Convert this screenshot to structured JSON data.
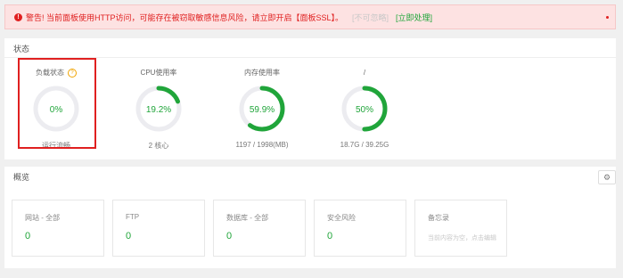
{
  "alert": {
    "text": "警告! 当前面板使用HTTP访问，可能存在被窃取敏感信息风险，请立即开启【面板SSL】。",
    "dismiss_label": "[不可忽略]",
    "fix_label": "[立即处理]"
  },
  "status": {
    "title": "状态",
    "gauges": [
      {
        "title": "负载状态",
        "value": "0%",
        "footer": "运行流畅",
        "percent": 0,
        "has_help": true
      },
      {
        "title": "CPU使用率",
        "value": "19.2%",
        "footer": "2 核心",
        "percent": 19.2,
        "has_help": false
      },
      {
        "title": "内存使用率",
        "value": "59.9%",
        "footer": "1197 / 1998(MB)",
        "percent": 59.9,
        "has_help": false
      },
      {
        "title": "/",
        "value": "50%",
        "footer": "18.7G / 39.25G",
        "percent": 50,
        "has_help": false
      }
    ]
  },
  "overview": {
    "title": "概览",
    "cards": [
      {
        "label": "网站 - 全部",
        "value": "0"
      },
      {
        "label": "FTP",
        "value": "0"
      },
      {
        "label": "数据库 - 全部",
        "value": "0"
      },
      {
        "label": "安全风险",
        "value": "0"
      },
      {
        "label": "备忘录",
        "hint": "当前内容为空，点击编辑"
      }
    ]
  },
  "colors": {
    "accent": "#20a53a",
    "danger": "#e02020",
    "track": "#ececf0"
  },
  "icons": {
    "alert": "warning-circle-icon",
    "help": "question-circle-icon",
    "settings": "gear-icon"
  }
}
